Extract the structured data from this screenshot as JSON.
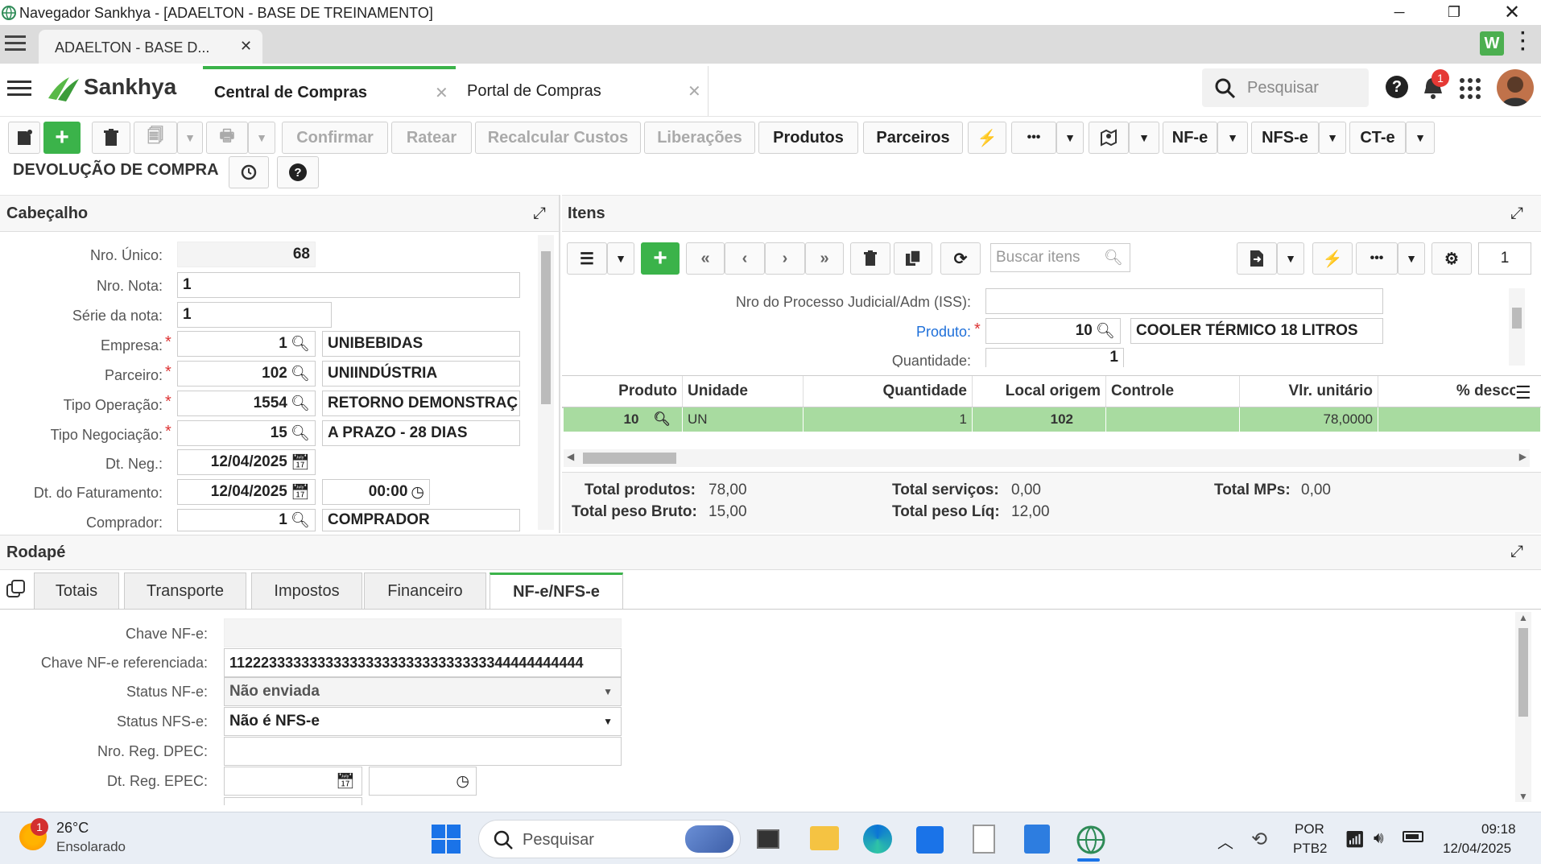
{
  "window": {
    "title": "Navegador Sankhya - [ADAELTON - BASE DE TREINAMENTO]"
  },
  "browser_tab": {
    "label": "ADAELTON - BASE D..."
  },
  "app": {
    "brand": "Sankhya",
    "tabs": [
      {
        "label": "Central de Compras"
      },
      {
        "label": "Portal de Compras"
      }
    ],
    "search_placeholder": "Pesquisar",
    "notification_count": "1"
  },
  "toolbar": {
    "confirmar": "Confirmar",
    "ratear": "Ratear",
    "recalcular": "Recalcular Custos",
    "liberacoes": "Liberações",
    "produtos": "Produtos",
    "parceiros": "Parceiros",
    "more": "•••",
    "nfe": "NF-e",
    "nfse": "NFS-e",
    "cte": "CT-e"
  },
  "page_title": "DEVOLUÇÃO DE COMPRA",
  "cabecalho": {
    "title": "Cabeçalho",
    "fields": {
      "nro_unico": {
        "label": "Nro. Único:",
        "value": "68"
      },
      "nro_nota": {
        "label": "Nro. Nota:",
        "value": "1"
      },
      "serie": {
        "label": "Série da nota:",
        "value": "1"
      },
      "empresa": {
        "label": "Empresa:",
        "code": "1",
        "desc": "UNIBEBIDAS"
      },
      "parceiro": {
        "label": "Parceiro:",
        "code": "102",
        "desc": "UNIINDÚSTRIA"
      },
      "tipo_operacao": {
        "label": "Tipo Operação:",
        "code": "1554",
        "desc": "RETORNO DEMONSTRAÇ"
      },
      "tipo_negociacao": {
        "label": "Tipo Negociação:",
        "code": "15",
        "desc": "A PRAZO - 28 DIAS"
      },
      "dt_neg": {
        "label": "Dt. Neg.:",
        "value": "12/04/2025"
      },
      "dt_fat": {
        "label": "Dt. do Faturamento:",
        "value": "12/04/2025",
        "time": "00:00"
      },
      "comprador": {
        "label": "Comprador:",
        "code": "1",
        "desc": "COMPRADOR"
      }
    }
  },
  "itens": {
    "title": "Itens",
    "search_placeholder": "Buscar itens",
    "page": "1",
    "form": {
      "processo_label": "Nro do Processo Judicial/Adm (ISS):",
      "produto_label": "Produto:",
      "produto_code": "10",
      "produto_desc": "COOLER TÉRMICO 18 LITROS",
      "quantidade_label": "Quantidade:",
      "quantidade_value": "1"
    },
    "columns": [
      "Produto",
      "Unidade",
      "Quantidade",
      "Local origem",
      "Controle",
      "Vlr. unitário",
      "% desco"
    ],
    "rows": [
      {
        "produto": "10",
        "unidade": "UN",
        "quantidade": "1",
        "local": "102",
        "controle": "",
        "vlr": "78,0000",
        "desc": ""
      }
    ],
    "totals": {
      "total_produtos_label": "Total produtos:",
      "total_produtos": "78,00",
      "total_servicos_label": "Total serviços:",
      "total_servicos": "0,00",
      "total_mps_label": "Total MPs:",
      "total_mps": "0,00",
      "peso_bruto_label": "Total peso Bruto:",
      "peso_bruto": "15,00",
      "peso_liq_label": "Total peso Líq:",
      "peso_liq": "12,00"
    }
  },
  "rodape": {
    "title": "Rodapé",
    "tabs": [
      "Totais",
      "Transporte",
      "Impostos",
      "Financeiro",
      "NF-e/NFS-e"
    ],
    "active_tab": "NF-e/NFS-e",
    "fields": {
      "chave_nfe": {
        "label": "Chave NF-e:",
        "value": ""
      },
      "chave_ref": {
        "label": "Chave NF-e referenciada:",
        "value": "11222333333333333333333333333333344444444444"
      },
      "status_nfe": {
        "label": "Status NF-e:",
        "value": "Não enviada"
      },
      "status_nfse": {
        "label": "Status NFS-e:",
        "value": "Não é NFS-e"
      },
      "dpec": {
        "label": "Nro. Reg. DPEC:",
        "value": ""
      },
      "epec": {
        "label": "Dt. Reg. EPEC:",
        "value": ""
      }
    }
  },
  "taskbar": {
    "weather_temp": "26°C",
    "weather_desc": "Ensolarado",
    "weather_badge": "1",
    "search_placeholder": "Pesquisar",
    "lang": "POR",
    "layout": "PTB2",
    "time": "09:18",
    "date": "12/04/2025"
  },
  "colors": {
    "brand_green": "#3bb34a",
    "row_selected": "#a8dba0",
    "required": "#d33333",
    "link_blue": "#1e6fd9"
  }
}
